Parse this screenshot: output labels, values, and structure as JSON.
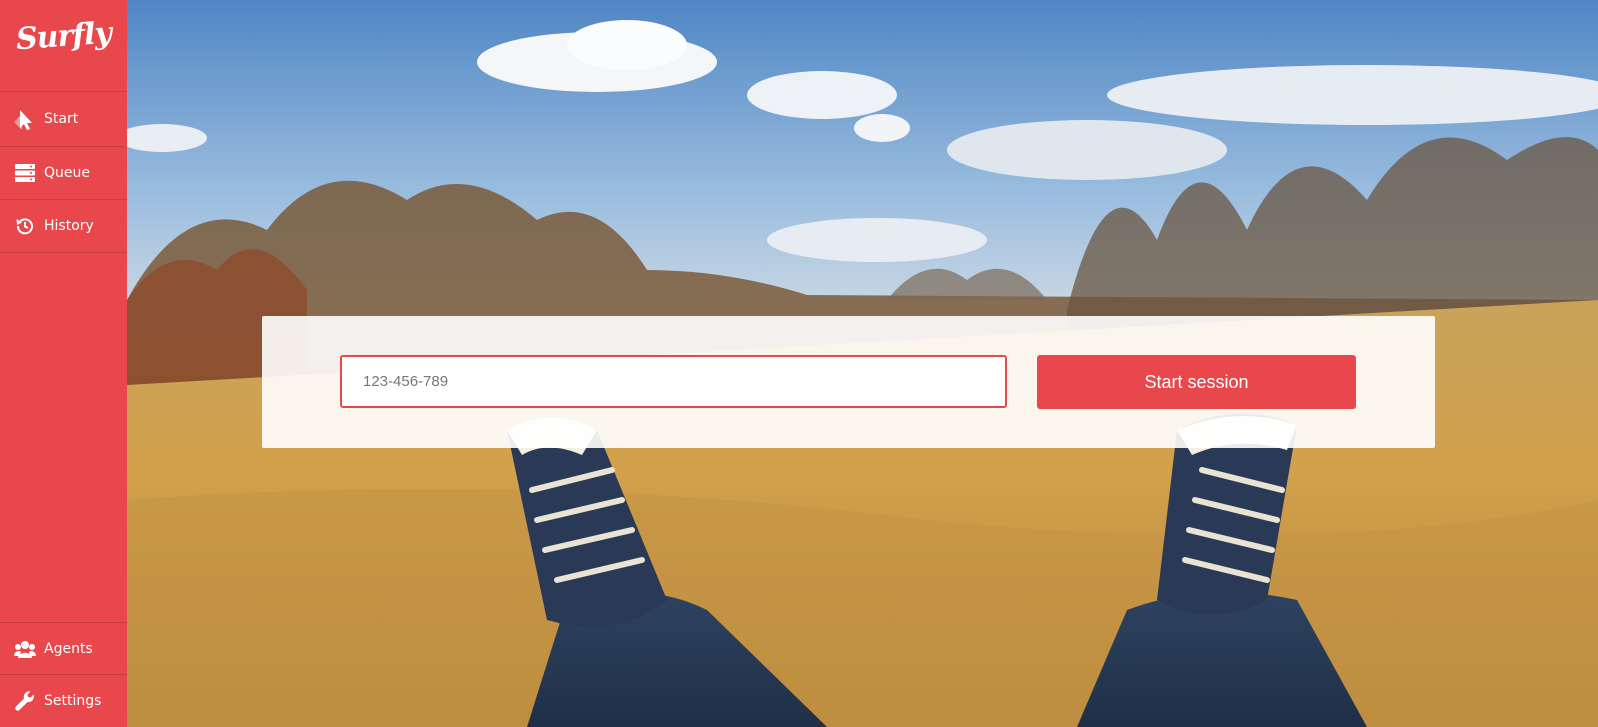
{
  "brand": {
    "logo_text": "Surfly"
  },
  "sidebar": {
    "items": [
      {
        "label": "Start",
        "icon": "cursor-icon",
        "active": true
      },
      {
        "label": "Queue",
        "icon": "server-stack-icon"
      },
      {
        "label": "History",
        "icon": "history-icon"
      }
    ],
    "bottom_items": [
      {
        "label": "Agents",
        "icon": "users-icon"
      },
      {
        "label": "Settings",
        "icon": "wrench-icon"
      }
    ]
  },
  "session": {
    "input_value": "123-456-789",
    "button_label": "Start session"
  },
  "colors": {
    "accent": "#e8474b",
    "sidebar_text": "#ffffff"
  }
}
